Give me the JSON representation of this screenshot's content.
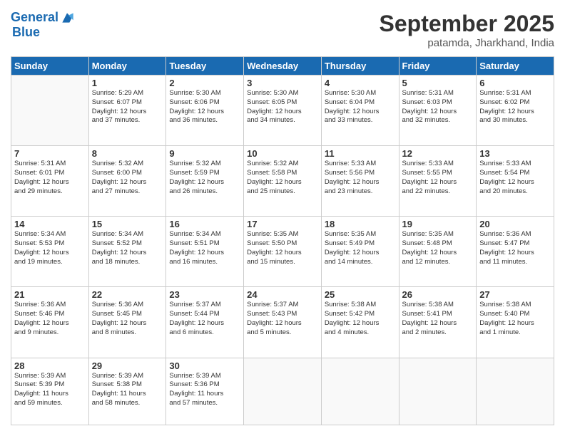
{
  "header": {
    "logo_line1": "General",
    "logo_line2": "Blue",
    "month_title": "September 2025",
    "location": "patamda, Jharkhand, India"
  },
  "days_of_week": [
    "Sunday",
    "Monday",
    "Tuesday",
    "Wednesday",
    "Thursday",
    "Friday",
    "Saturday"
  ],
  "weeks": [
    [
      {
        "day": "",
        "text": ""
      },
      {
        "day": "1",
        "text": "Sunrise: 5:29 AM\nSunset: 6:07 PM\nDaylight: 12 hours\nand 37 minutes."
      },
      {
        "day": "2",
        "text": "Sunrise: 5:30 AM\nSunset: 6:06 PM\nDaylight: 12 hours\nand 36 minutes."
      },
      {
        "day": "3",
        "text": "Sunrise: 5:30 AM\nSunset: 6:05 PM\nDaylight: 12 hours\nand 34 minutes."
      },
      {
        "day": "4",
        "text": "Sunrise: 5:30 AM\nSunset: 6:04 PM\nDaylight: 12 hours\nand 33 minutes."
      },
      {
        "day": "5",
        "text": "Sunrise: 5:31 AM\nSunset: 6:03 PM\nDaylight: 12 hours\nand 32 minutes."
      },
      {
        "day": "6",
        "text": "Sunrise: 5:31 AM\nSunset: 6:02 PM\nDaylight: 12 hours\nand 30 minutes."
      }
    ],
    [
      {
        "day": "7",
        "text": "Sunrise: 5:31 AM\nSunset: 6:01 PM\nDaylight: 12 hours\nand 29 minutes."
      },
      {
        "day": "8",
        "text": "Sunrise: 5:32 AM\nSunset: 6:00 PM\nDaylight: 12 hours\nand 27 minutes."
      },
      {
        "day": "9",
        "text": "Sunrise: 5:32 AM\nSunset: 5:59 PM\nDaylight: 12 hours\nand 26 minutes."
      },
      {
        "day": "10",
        "text": "Sunrise: 5:32 AM\nSunset: 5:58 PM\nDaylight: 12 hours\nand 25 minutes."
      },
      {
        "day": "11",
        "text": "Sunrise: 5:33 AM\nSunset: 5:56 PM\nDaylight: 12 hours\nand 23 minutes."
      },
      {
        "day": "12",
        "text": "Sunrise: 5:33 AM\nSunset: 5:55 PM\nDaylight: 12 hours\nand 22 minutes."
      },
      {
        "day": "13",
        "text": "Sunrise: 5:33 AM\nSunset: 5:54 PM\nDaylight: 12 hours\nand 20 minutes."
      }
    ],
    [
      {
        "day": "14",
        "text": "Sunrise: 5:34 AM\nSunset: 5:53 PM\nDaylight: 12 hours\nand 19 minutes."
      },
      {
        "day": "15",
        "text": "Sunrise: 5:34 AM\nSunset: 5:52 PM\nDaylight: 12 hours\nand 18 minutes."
      },
      {
        "day": "16",
        "text": "Sunrise: 5:34 AM\nSunset: 5:51 PM\nDaylight: 12 hours\nand 16 minutes."
      },
      {
        "day": "17",
        "text": "Sunrise: 5:35 AM\nSunset: 5:50 PM\nDaylight: 12 hours\nand 15 minutes."
      },
      {
        "day": "18",
        "text": "Sunrise: 5:35 AM\nSunset: 5:49 PM\nDaylight: 12 hours\nand 14 minutes."
      },
      {
        "day": "19",
        "text": "Sunrise: 5:35 AM\nSunset: 5:48 PM\nDaylight: 12 hours\nand 12 minutes."
      },
      {
        "day": "20",
        "text": "Sunrise: 5:36 AM\nSunset: 5:47 PM\nDaylight: 12 hours\nand 11 minutes."
      }
    ],
    [
      {
        "day": "21",
        "text": "Sunrise: 5:36 AM\nSunset: 5:46 PM\nDaylight: 12 hours\nand 9 minutes."
      },
      {
        "day": "22",
        "text": "Sunrise: 5:36 AM\nSunset: 5:45 PM\nDaylight: 12 hours\nand 8 minutes."
      },
      {
        "day": "23",
        "text": "Sunrise: 5:37 AM\nSunset: 5:44 PM\nDaylight: 12 hours\nand 6 minutes."
      },
      {
        "day": "24",
        "text": "Sunrise: 5:37 AM\nSunset: 5:43 PM\nDaylight: 12 hours\nand 5 minutes."
      },
      {
        "day": "25",
        "text": "Sunrise: 5:38 AM\nSunset: 5:42 PM\nDaylight: 12 hours\nand 4 minutes."
      },
      {
        "day": "26",
        "text": "Sunrise: 5:38 AM\nSunset: 5:41 PM\nDaylight: 12 hours\nand 2 minutes."
      },
      {
        "day": "27",
        "text": "Sunrise: 5:38 AM\nSunset: 5:40 PM\nDaylight: 12 hours\nand 1 minute."
      }
    ],
    [
      {
        "day": "28",
        "text": "Sunrise: 5:39 AM\nSunset: 5:39 PM\nDaylight: 11 hours\nand 59 minutes."
      },
      {
        "day": "29",
        "text": "Sunrise: 5:39 AM\nSunset: 5:38 PM\nDaylight: 11 hours\nand 58 minutes."
      },
      {
        "day": "30",
        "text": "Sunrise: 5:39 AM\nSunset: 5:36 PM\nDaylight: 11 hours\nand 57 minutes."
      },
      {
        "day": "",
        "text": ""
      },
      {
        "day": "",
        "text": ""
      },
      {
        "day": "",
        "text": ""
      },
      {
        "day": "",
        "text": ""
      }
    ]
  ]
}
